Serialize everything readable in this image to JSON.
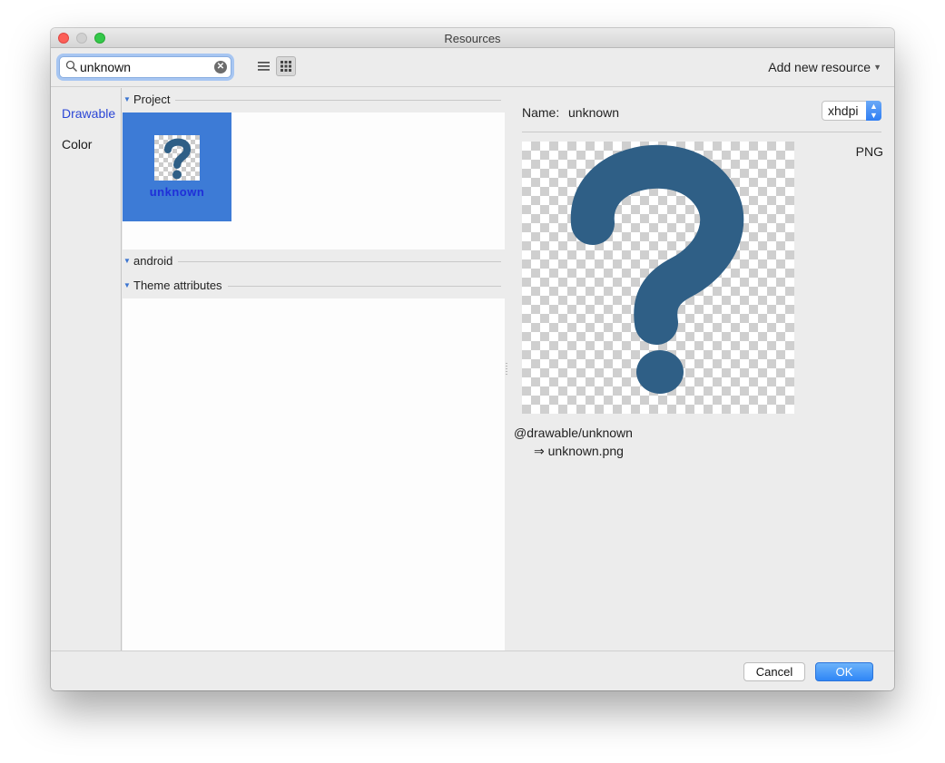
{
  "window": {
    "title": "Resources"
  },
  "toolbar": {
    "search_value": "unknown",
    "add_resource_label": "Add new resource"
  },
  "sidebar": {
    "items": [
      {
        "label": "Drawable",
        "active": true
      },
      {
        "label": "Color",
        "active": false
      }
    ]
  },
  "center": {
    "sections": [
      {
        "label": "Project",
        "expanded": true
      },
      {
        "label": "android",
        "expanded": true
      },
      {
        "label": "Theme attributes",
        "expanded": true
      }
    ],
    "tile": {
      "label": "unknown",
      "selected": true
    }
  },
  "detail": {
    "name_label": "Name:",
    "name_value": "unknown",
    "density": "xhdpi",
    "format": "PNG",
    "reference": "@drawable/unknown",
    "file": "⇒ unknown.png"
  },
  "footer": {
    "cancel_label": "Cancel",
    "ok_label": "OK"
  },
  "colors": {
    "accent": "#3d7bd6",
    "active_sidebar_text": "#2b46d6",
    "question_mark": "#2f5f86"
  }
}
